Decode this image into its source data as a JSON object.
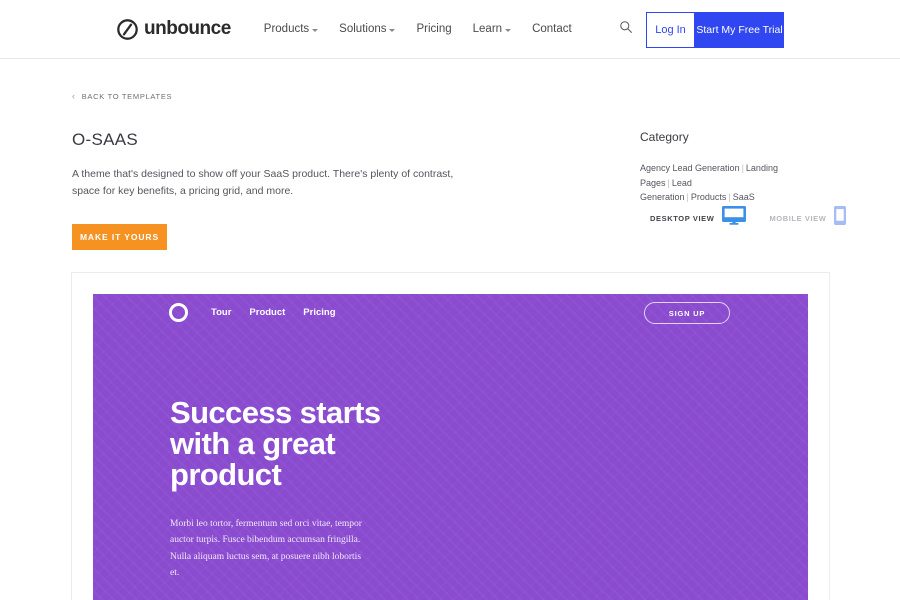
{
  "header": {
    "logo_text": "unbounce",
    "logo_icon": "unbounce-circle-slash-icon",
    "nav": [
      {
        "label": "Products",
        "has_caret": true
      },
      {
        "label": "Solutions",
        "has_caret": true
      },
      {
        "label": "Pricing",
        "has_caret": false
      },
      {
        "label": "Learn",
        "has_caret": true
      },
      {
        "label": "Contact",
        "has_caret": false
      }
    ],
    "search_icon": "search-icon",
    "login_label": "Log In",
    "trial_label": "Start My Free Trial",
    "accent_blue": "#2f46f0"
  },
  "breadcrumb": {
    "chevron": "‹",
    "label": "BACK TO TEMPLATES"
  },
  "template": {
    "title": "O-SAAS",
    "description": "A theme that's designed to show off your SaaS product. There's plenty of contrast, space for key benefits, a pricing grid, and more.",
    "cta_label": "MAKE IT YOURS",
    "cta_color": "#f59222"
  },
  "category": {
    "heading": "Category",
    "items": [
      "Agency Lead Generation",
      "Landing Pages",
      "Lead Generation",
      "Products",
      "SaaS"
    ],
    "separator": "|"
  },
  "view_toggle": {
    "desktop_label": "DESKTOP VIEW",
    "desktop_icon": "desktop-monitor-icon",
    "desktop_active": true,
    "mobile_label": "MOBILE VIEW",
    "mobile_icon": "mobile-phone-icon",
    "mobile_active": false,
    "active_color": "#3b90e8",
    "inactive_color": "#a7bcf4"
  },
  "preview": {
    "background_color": "#8a4bcf",
    "logo_icon": "ring-logo-icon",
    "nav": [
      "Tour",
      "Product",
      "Pricing"
    ],
    "signup_label": "SIGN UP",
    "headline_lines": [
      "Success starts",
      "with a great",
      "product"
    ],
    "body": "Morbi leo tortor, fermentum sed orci vitae, tempor auctor turpis. Fusce bibendum accumsan fringilla. Nulla aliquam luctus sem, at posuere nibh lobortis et."
  }
}
